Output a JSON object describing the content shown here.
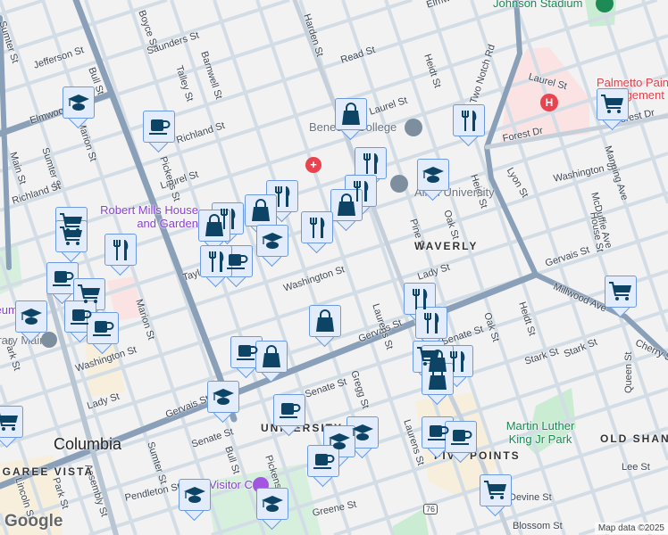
{
  "map": {
    "attribution": "Map data ©2025",
    "logo": "Google",
    "colors": {
      "major_road": "#8aa0b8",
      "minor_road": "#d3dde6",
      "background": "#f3f2f3",
      "marker_fill": "#e3ecfb",
      "marker_border": "#6b9ae0",
      "icon": "#0d4466"
    },
    "streets": [
      "Sumter St",
      "Boyce St",
      "Saunders St",
      "Jefferson St",
      "Bull St",
      "Talley St",
      "Barnwell St",
      "Harden St",
      "Read St",
      "Laurel St",
      "Richland St",
      "Elmwood",
      "Marion St",
      "Main St",
      "Pickens St",
      "Taylor St",
      "Washington St",
      "Lady St",
      "Gervais St",
      "Senate St",
      "Gregg St",
      "Laurens St",
      "Pine St",
      "Oak St",
      "Heidt St",
      "Two Notch Rd",
      "Forest Dr",
      "Lyon St",
      "Manning Ave",
      "McDuffie Ave",
      "House St",
      "Millwood Ave",
      "Stark St",
      "Cherry St",
      "Queen St",
      "Lee St",
      "Devine St",
      "Blossom St",
      "Pendleton St",
      "Greene St",
      "Assembly St",
      "Park St",
      "Lincoln St",
      "Elmwood Ave"
    ],
    "places": {
      "stadium": "Johnson Stadium",
      "college": "Benedict College",
      "university": "Allen University",
      "house": "Robert Mills House and Garden",
      "palmetto": "Palmetto Pain Management",
      "waverly": "WAVERLY",
      "columbia": "Columbia",
      "university_hill": "UNIVERSITY HILL",
      "vista": "CONGAREE VISTA",
      "five_points": "FIVE POINTS",
      "mlk_park": "Martin Luther King Jr Park",
      "old_shandon": "OLD SHANDON",
      "visitor": "Visitor Ctr",
      "museum": "Museum",
      "library": "Library Main",
      "route": "76"
    },
    "marker_types": {
      "grad": "school-icon",
      "cup": "cafe-icon",
      "bag": "shopping-icon",
      "fork": "restaurant-icon",
      "cart": "grocery-icon"
    }
  }
}
